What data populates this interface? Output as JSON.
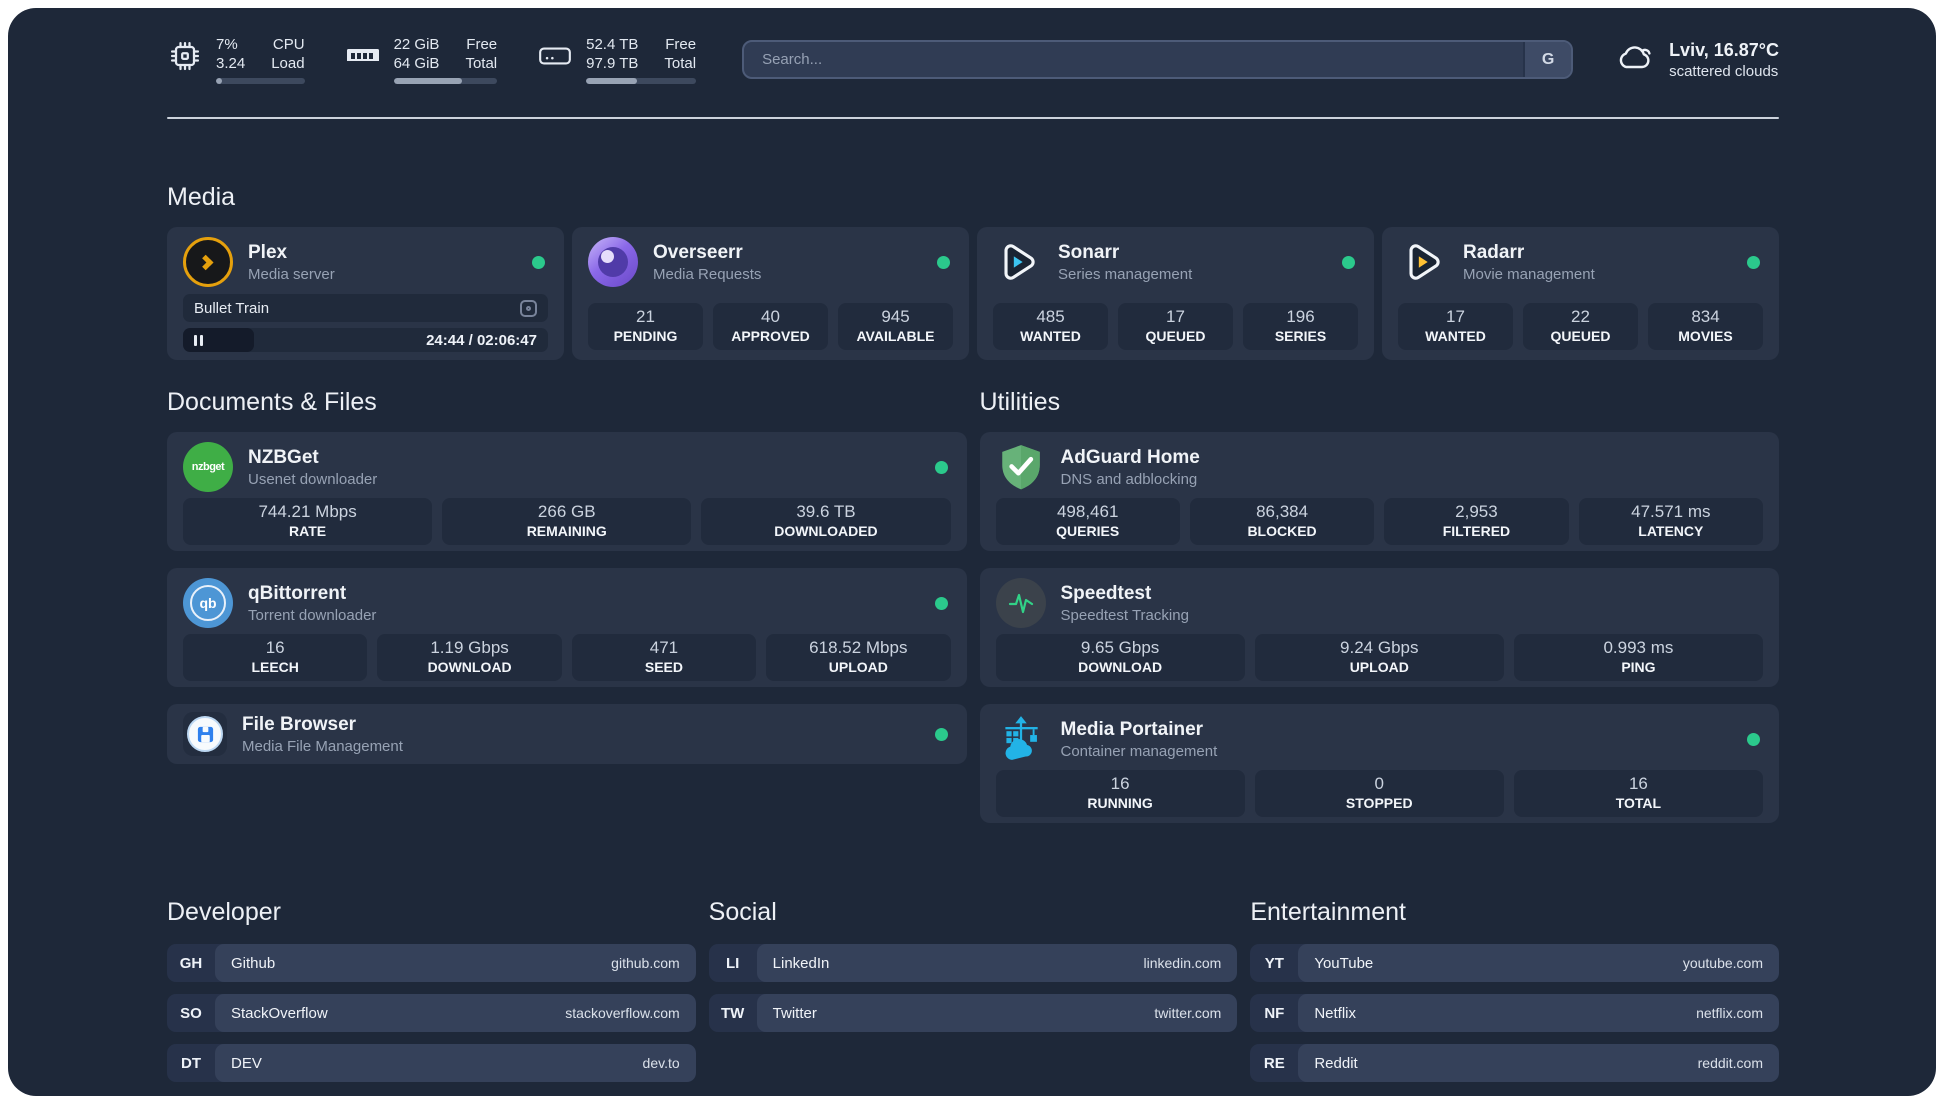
{
  "colors": {
    "status_online": "#2bc98c",
    "background": "#1e2839",
    "card": "#2a3447",
    "plex_amber": "#e5a00d",
    "sonarr_blue": "#3cc5f1",
    "radarr_amber": "#ffc234",
    "portainer_blue": "#22b3e6",
    "adguard_green": "#67b279"
  },
  "topbar": {
    "system_stats": [
      {
        "icon": "cpu-icon",
        "values": [
          "7%",
          "3.24"
        ],
        "labels": [
          "CPU",
          "Load"
        ],
        "usage_pct": 7
      },
      {
        "icon": "memory-icon",
        "values": [
          "22 GiB",
          "64 GiB"
        ],
        "labels": [
          "Free",
          "Total"
        ],
        "usage_pct": 66
      },
      {
        "icon": "disk-icon",
        "values": [
          "52.4 TB",
          "97.9 TB"
        ],
        "labels": [
          "Free",
          "Total"
        ],
        "usage_pct": 46
      }
    ],
    "search": {
      "placeholder": "Search...",
      "engine_button": "G"
    },
    "weather": {
      "icon": "cloud-icon",
      "location_temp": "Lviv, 16.87°C",
      "condition": "scattered clouds"
    }
  },
  "sections": {
    "media": {
      "title": "Media",
      "cards": [
        {
          "icon": "plex-icon",
          "title": "Plex",
          "subtitle": "Media server",
          "status": "online",
          "now_playing": {
            "title": "Bullet Train",
            "time": "24:44 / 02:06:47",
            "progress_pct": 19.5
          }
        },
        {
          "icon": "overseerr-icon",
          "title": "Overseerr",
          "subtitle": "Media Requests",
          "status": "online",
          "stats": [
            {
              "value": "21",
              "label": "PENDING"
            },
            {
              "value": "40",
              "label": "APPROVED"
            },
            {
              "value": "945",
              "label": "AVAILABLE"
            }
          ]
        },
        {
          "icon": "sonarr-icon",
          "title": "Sonarr",
          "subtitle": "Series management",
          "status": "online",
          "stats": [
            {
              "value": "485",
              "label": "WANTED"
            },
            {
              "value": "17",
              "label": "QUEUED"
            },
            {
              "value": "196",
              "label": "SERIES"
            }
          ]
        },
        {
          "icon": "radarr-icon",
          "title": "Radarr",
          "subtitle": "Movie management",
          "status": "online",
          "stats": [
            {
              "value": "17",
              "label": "WANTED"
            },
            {
              "value": "22",
              "label": "QUEUED"
            },
            {
              "value": "834",
              "label": "MOVIES"
            }
          ]
        }
      ]
    },
    "documents": {
      "title": "Documents & Files",
      "cards": [
        {
          "icon": "nzbget-icon",
          "icon_label": "nzbget",
          "title": "NZBGet",
          "subtitle": "Usenet downloader",
          "status": "online",
          "stats": [
            {
              "value": "744.21 Mbps",
              "label": "RATE"
            },
            {
              "value": "266 GB",
              "label": "REMAINING"
            },
            {
              "value": "39.6 TB",
              "label": "DOWNLOADED"
            }
          ]
        },
        {
          "icon": "qbittorrent-icon",
          "icon_label": "qb",
          "title": "qBittorrent",
          "subtitle": "Torrent downloader",
          "status": "online",
          "stats": [
            {
              "value": "16",
              "label": "LEECH"
            },
            {
              "value": "1.19 Gbps",
              "label": "DOWNLOAD"
            },
            {
              "value": "471",
              "label": "SEED"
            },
            {
              "value": "618.52 Mbps",
              "label": "UPLOAD"
            }
          ]
        },
        {
          "icon": "filebrowser-icon",
          "title": "File Browser",
          "subtitle": "Media File Management",
          "status": "online"
        }
      ]
    },
    "utilities": {
      "title": "Utilities",
      "cards": [
        {
          "icon": "adguard-icon",
          "title": "AdGuard Home",
          "subtitle": "DNS and adblocking",
          "stats": [
            {
              "value": "498,461",
              "label": "QUERIES"
            },
            {
              "value": "86,384",
              "label": "BLOCKED"
            },
            {
              "value": "2,953",
              "label": "FILTERED"
            },
            {
              "value": "47.571 ms",
              "label": "LATENCY"
            }
          ]
        },
        {
          "icon": "speedtest-icon",
          "title": "Speedtest",
          "subtitle": "Speedtest Tracking",
          "stats": [
            {
              "value": "9.65 Gbps",
              "label": "DOWNLOAD"
            },
            {
              "value": "9.24 Gbps",
              "label": "UPLOAD"
            },
            {
              "value": "0.993 ms",
              "label": "PING"
            }
          ]
        },
        {
          "icon": "portainer-icon",
          "title": "Media Portainer",
          "subtitle": "Container management",
          "status": "online",
          "stats": [
            {
              "value": "16",
              "label": "RUNNING"
            },
            {
              "value": "0",
              "label": "STOPPED"
            },
            {
              "value": "16",
              "label": "TOTAL"
            }
          ]
        }
      ]
    },
    "links": [
      {
        "title": "Developer",
        "items": [
          {
            "abbr": "GH",
            "name": "Github",
            "url": "github.com"
          },
          {
            "abbr": "SO",
            "name": "StackOverflow",
            "url": "stackoverflow.com"
          },
          {
            "abbr": "DT",
            "name": "DEV",
            "url": "dev.to"
          }
        ]
      },
      {
        "title": "Social",
        "items": [
          {
            "abbr": "LI",
            "name": "LinkedIn",
            "url": "linkedin.com"
          },
          {
            "abbr": "TW",
            "name": "Twitter",
            "url": "twitter.com"
          }
        ]
      },
      {
        "title": "Entertainment",
        "items": [
          {
            "abbr": "YT",
            "name": "YouTube",
            "url": "youtube.com"
          },
          {
            "abbr": "NF",
            "name": "Netflix",
            "url": "netflix.com"
          },
          {
            "abbr": "RE",
            "name": "Reddit",
            "url": "reddit.com"
          }
        ]
      }
    ]
  }
}
